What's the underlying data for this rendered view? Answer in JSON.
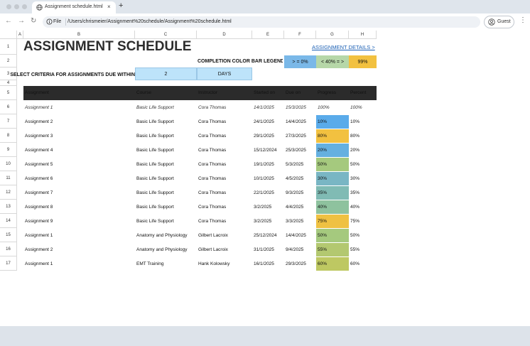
{
  "browser": {
    "tab_title": "Assignment schedule.html",
    "tab_close": "×",
    "new_tab": "+",
    "omnibox_scheme": "File",
    "url": "/Users/chrismeier/Assignment%20schedule/Assignment%20schedule.html",
    "profile_label": "Guest",
    "back": "←",
    "forward": "→",
    "reload": "↻",
    "menu": "⋮"
  },
  "sheet": {
    "columns": [
      "A",
      "B",
      "C",
      "D",
      "E",
      "F",
      "G",
      "H"
    ],
    "row_numbers": [
      "1",
      "2",
      "3",
      "4",
      "5",
      "6",
      "7",
      "8",
      "9",
      "10",
      "11",
      "12",
      "13",
      "14",
      "15",
      "16",
      "17"
    ],
    "title": "ASSIGNMENT SCHEDULE",
    "details_link": "ASSIGNMENT DETAILS >",
    "legend_label": "COMPLETION COLOR BAR LEGEND",
    "legend": [
      {
        "label": "> = 0%",
        "color": "#7ab8e8"
      },
      {
        "label": "< 40% = >",
        "color": "#b6d7a8"
      },
      {
        "label": "99%",
        "color": "#f2c140"
      }
    ],
    "criteria_label": "SELECT CRITERIA FOR ASSIGNMENTS DUE WITHIN",
    "criteria_value": "2",
    "criteria_unit": "DAYS",
    "headers": {
      "assignment": "Assignment",
      "course": "Course",
      "instructor": "Instructor",
      "started": "Started on",
      "due": "Due on",
      "progress": "Progress",
      "percent": "Percent"
    },
    "rows": [
      {
        "assignment": "Assignment 1",
        "course": "Basic Life Support",
        "instructor": "Cora Thomas",
        "started": "14/1/2025",
        "due": "15/3/2025",
        "progress": "100%",
        "percent": "100%",
        "fill": 1.0,
        "color": "#ffffff",
        "italic": true
      },
      {
        "assignment": "Assignment 2",
        "course": "Basic Life Support",
        "instructor": "Cora Thomas",
        "started": "24/1/2025",
        "due": "14/4/2025",
        "progress": "10%",
        "percent": "10%",
        "fill": 0.1,
        "color": "#5aabea"
      },
      {
        "assignment": "Assignment 3",
        "course": "Basic Life Support",
        "instructor": "Cora Thomas",
        "started": "29/1/2025",
        "due": "27/3/2025",
        "progress": "80%",
        "percent": "80%",
        "fill": 0.8,
        "color": "#f2c140"
      },
      {
        "assignment": "Assignment 4",
        "course": "Basic Life Support",
        "instructor": "Cora Thomas",
        "started": "15/12/2024",
        "due": "25/3/2025",
        "progress": "20%",
        "percent": "20%",
        "fill": 0.2,
        "color": "#65b0e0"
      },
      {
        "assignment": "Assignment 5",
        "course": "Basic Life Support",
        "instructor": "Cora Thomas",
        "started": "19/1/2025",
        "due": "5/3/2025",
        "progress": "50%",
        "percent": "50%",
        "fill": 0.5,
        "color": "#a5c97e"
      },
      {
        "assignment": "Assignment 6",
        "course": "Basic Life Support",
        "instructor": "Cora Thomas",
        "started": "10/1/2025",
        "due": "4/5/2025",
        "progress": "30%",
        "percent": "30%",
        "fill": 0.3,
        "color": "#79b6c4"
      },
      {
        "assignment": "Assignment 7",
        "course": "Basic Life Support",
        "instructor": "Cora Thomas",
        "started": "22/1/2025",
        "due": "9/3/2025",
        "progress": "35%",
        "percent": "35%",
        "fill": 0.35,
        "color": "#80bbb4"
      },
      {
        "assignment": "Assignment 8",
        "course": "Basic Life Support",
        "instructor": "Cora Thomas",
        "started": "3/2/2025",
        "due": "4/4/2025",
        "progress": "40%",
        "percent": "40%",
        "fill": 0.4,
        "color": "#8ec29e"
      },
      {
        "assignment": "Assignment 9",
        "course": "Basic Life Support",
        "instructor": "Cora Thomas",
        "started": "3/2/2025",
        "due": "3/3/2025",
        "progress": "75%",
        "percent": "75%",
        "fill": 0.75,
        "color": "#efc142"
      },
      {
        "assignment": "Assignment 1",
        "course": "Anatomy and Physiology",
        "instructor": "Gilbert Lacroix",
        "started": "25/12/2024",
        "due": "14/4/2025",
        "progress": "50%",
        "percent": "50%",
        "fill": 0.5,
        "color": "#a5c97e"
      },
      {
        "assignment": "Assignment 2",
        "course": "Anatomy and Physiology",
        "instructor": "Gilbert Lacroix",
        "started": "31/1/2025",
        "due": "9/4/2025",
        "progress": "55%",
        "percent": "55%",
        "fill": 0.55,
        "color": "#b3c870"
      },
      {
        "assignment": "Assignment 1",
        "course": "EMT Training",
        "instructor": "Hank Kolowsky",
        "started": "16/1/2025",
        "due": "29/3/2025",
        "progress": "60%",
        "percent": "60%",
        "fill": 0.6,
        "color": "#bec862"
      }
    ]
  }
}
